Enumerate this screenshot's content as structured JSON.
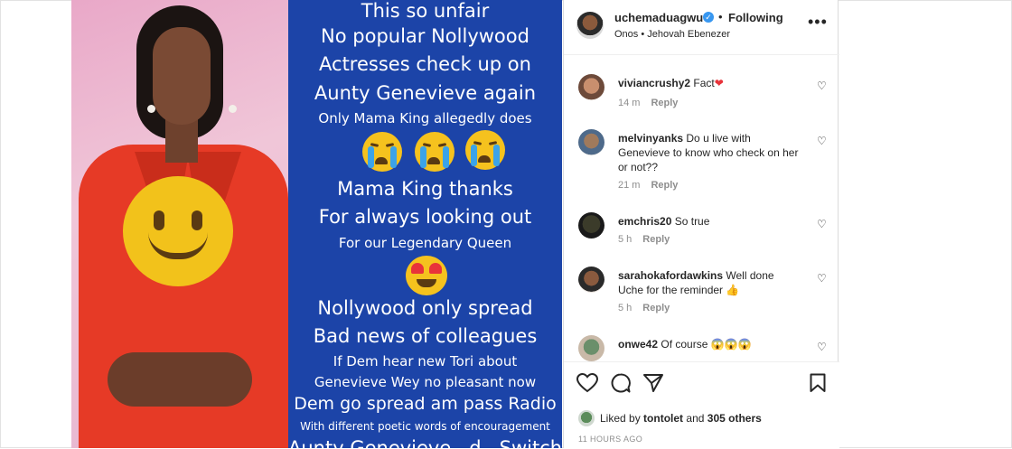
{
  "post": {
    "image_text": [
      {
        "text": "This so unfair",
        "size": "big"
      },
      {
        "text": "No popular Nollywood",
        "size": "big"
      },
      {
        "text": "Actresses check up on",
        "size": "big"
      },
      {
        "text": "Aunty Genevieve again",
        "size": "big"
      },
      {
        "text": "Only Mama King allegedly does",
        "size": "sml"
      },
      {
        "text": "Mama King thanks",
        "size": "big"
      },
      {
        "text": "For always looking out",
        "size": "big"
      },
      {
        "text": "For our Legendary Queen",
        "size": "sml"
      },
      {
        "text": "Nollywood only spread",
        "size": "big"
      },
      {
        "text": "Bad news of colleagues",
        "size": "big"
      },
      {
        "text": "If Dem hear new Tori about",
        "size": "sml"
      },
      {
        "text": "Genevieve Wey no pleasant now",
        "size": "sml"
      },
      {
        "text": "Dem go spread am pass Radio",
        "size": "big"
      },
      {
        "text": "With different poetic words of encouragement",
        "size": "xs"
      },
      {
        "text": "Aunty Genevieve ..d.. Switch",
        "size": "big"
      }
    ],
    "emoji": {
      "crying": "crying-face-emoji",
      "heart_eyes": "heart-eyes-emoji",
      "smiley": "smiley-face-emoji"
    },
    "colors": {
      "text_panel": "#1c44a8",
      "jacket": "#e63a26",
      "accent_blue": "#3897f0"
    }
  },
  "header": {
    "username": "uchemaduagwu",
    "separator": "•",
    "follow_status": "Following",
    "audio": "Onos • Jehovah Ebenezer",
    "more": "•••"
  },
  "comments": [
    {
      "user": "viviancrushy2",
      "text": "Fact",
      "emoji_suffix": "❤",
      "time": "14 m",
      "reply": "Reply"
    },
    {
      "user": "melvinyanks",
      "text": "Do u live with Genevieve to know who check on her or not??",
      "emoji_suffix": "",
      "time": "21 m",
      "reply": "Reply"
    },
    {
      "user": "emchris20",
      "text": "So true",
      "emoji_suffix": "",
      "time": "5 h",
      "reply": "Reply"
    },
    {
      "user": "sarahokafordawkins",
      "text": "Well done Uche for the reminder",
      "emoji_suffix": "👍",
      "time": "5 h",
      "reply": "Reply"
    },
    {
      "user": "onwe42",
      "text": "Of course",
      "emoji_suffix": "😱😱😱",
      "time": "",
      "reply": ""
    }
  ],
  "likes": {
    "prefix": "Liked by",
    "user": "tontolet",
    "connector": "and",
    "others": "305 others"
  },
  "time_ago": "11 HOURS AGO"
}
